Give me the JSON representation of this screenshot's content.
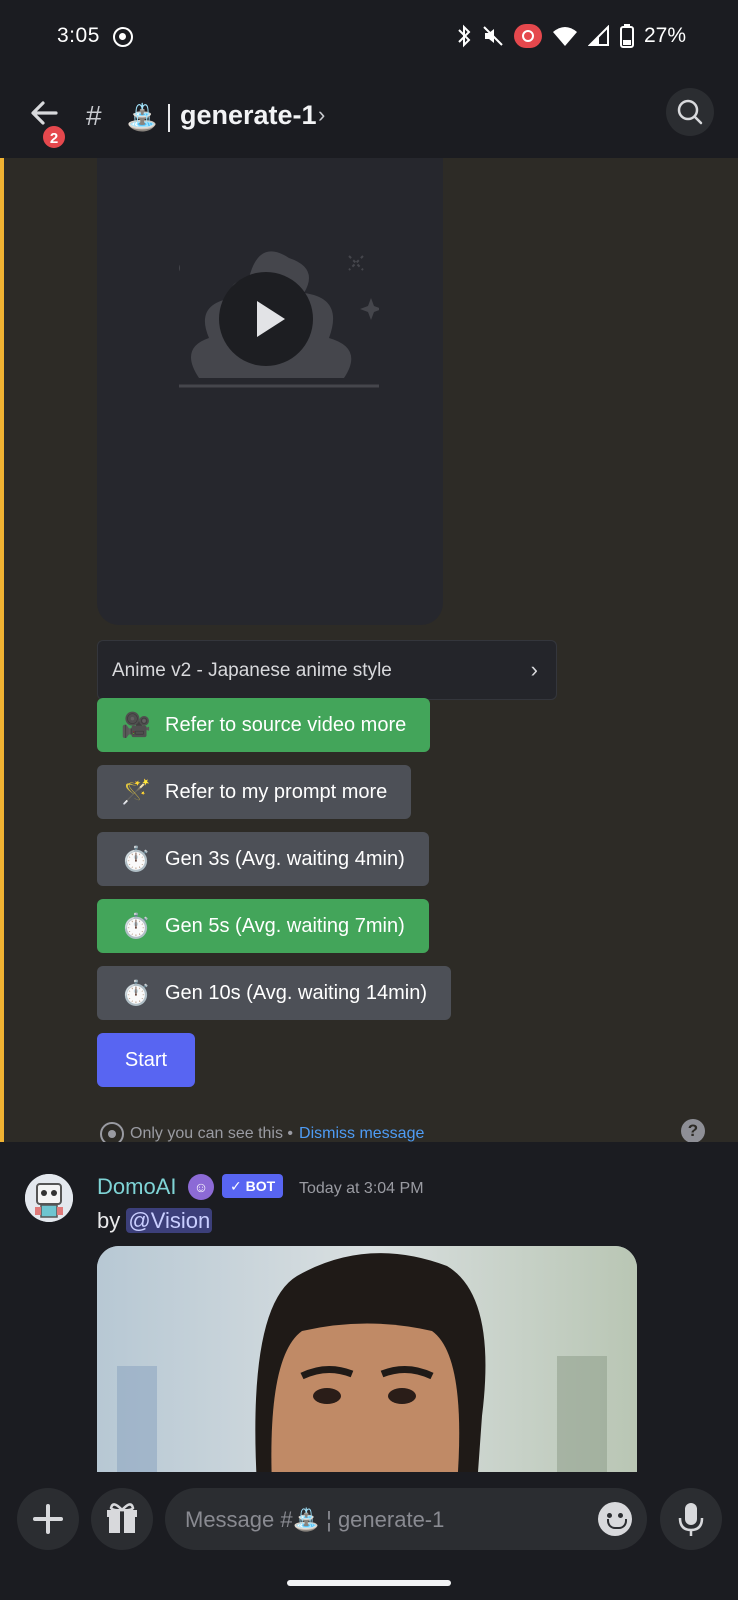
{
  "status_bar": {
    "time": "3:05",
    "battery_percent": "27%",
    "icons": [
      "screen-record-icon",
      "bluetooth-icon",
      "mute-icon",
      "recording-icon",
      "wifi-icon",
      "signal-icon",
      "battery-icon"
    ]
  },
  "header": {
    "unread_badge": "2",
    "channel_emoji": "⛲",
    "channel_name": "generate-1",
    "chevron": "›"
  },
  "ephemeral": {
    "select_menu_label": "Anime v2 - Japanese anime style",
    "buttons": [
      {
        "icon": "🎥",
        "label": "Refer to source video more",
        "style": "green"
      },
      {
        "icon": "🪄",
        "label": "Refer to my prompt more",
        "style": "grey"
      },
      {
        "icon": "⏱️",
        "label": "Gen 3s (Avg. waiting 4min)",
        "style": "grey"
      },
      {
        "icon": "⏱️",
        "label": "Gen 5s (Avg. waiting 7min)",
        "style": "green"
      },
      {
        "icon": "⏱️",
        "label": "Gen 10s (Avg. waiting 14min)",
        "style": "grey"
      }
    ],
    "start_label": "Start",
    "note_text": "Only you can see this •",
    "dismiss_label": "Dismiss message",
    "help_label": "?"
  },
  "message": {
    "author": "DomoAI",
    "bot_tag": "✓ BOT",
    "timestamp": "Today at 3:04 PM",
    "by_prefix": "by",
    "mention": "@Vision"
  },
  "composer": {
    "placeholder": "Message #⛲ ¦ generate-1"
  },
  "colors": {
    "background": "#1b1c21",
    "ephemeral_bg": "#2d2b26",
    "ephemeral_border": "#f0b232",
    "green_button": "#43a55a",
    "grey_button": "#4d5057",
    "blurple": "#5865f2",
    "link": "#4e9cf5",
    "author": "#7fd4d6"
  }
}
